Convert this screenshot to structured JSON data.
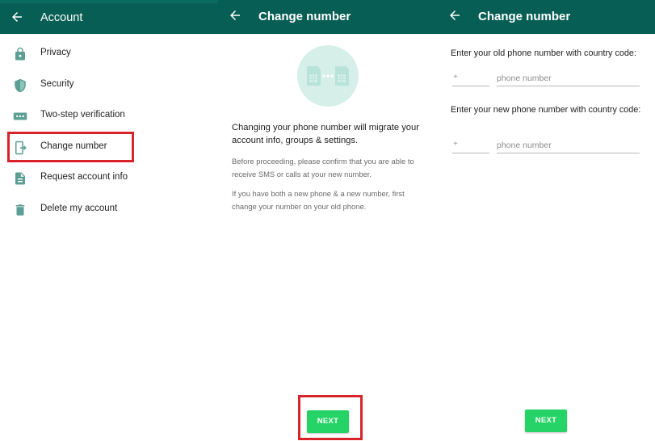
{
  "panel1": {
    "title": "Account",
    "items": [
      {
        "label": "Privacy",
        "icon": "lock-icon"
      },
      {
        "label": "Security",
        "icon": "shield-icon"
      },
      {
        "label": "Two-step verification",
        "icon": "dots-icon"
      },
      {
        "label": "Change number",
        "icon": "change-number-icon"
      },
      {
        "label": "Request account info",
        "icon": "document-icon"
      },
      {
        "label": "Delete my account",
        "icon": "trash-icon"
      }
    ]
  },
  "panel2": {
    "title": "Change number",
    "main_text": "Changing your phone number will migrate your account info, groups & settings.",
    "note1": "Before proceeding, please confirm that you are able to receive SMS or calls at your new number.",
    "note2": "If you have both a new phone & a new number, first change your number on your old phone.",
    "next_label": "NEXT"
  },
  "panel3": {
    "title": "Change number",
    "old_label": "Enter your old phone number with country code:",
    "new_label": "Enter your new phone number with country code:",
    "country_prefix": "+",
    "phone_placeholder": "phone number",
    "next_label": "NEXT"
  },
  "colors": {
    "appbar": "#075e54",
    "accent": "#25d366",
    "icon": "#5b9e93",
    "highlight": "#d9232a"
  }
}
